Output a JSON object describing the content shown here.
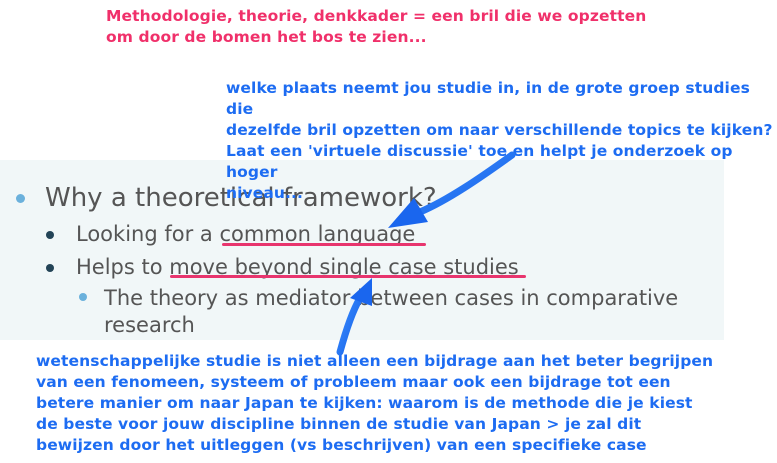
{
  "annotations": {
    "top_pink": "Methodologie, theorie, denkkader = een bril die we opzetten\nom door de bomen het bos te zien...",
    "top_blue": "welke plaats neemt jou studie in, in de grote groep studies die\ndezelfde bril opzetten om naar verschillende topics te kijken?\nLaat een 'virtuele discussie' toe en helpt je onderzoek op hoger\nniveau...",
    "bottom_blue": "wetenschappelijke studie is niet alleen een bijdrage aan het beter begrijpen\nvan een fenomeen, systeem of probleem maar ook een bijdrage tot een\nbetere manier om naar Japan te kijken: waarom is de methode die je kiest\nde beste voor jouw discipline binnen de studie van Japan > je zal dit\nbewijzen door het uitleggen (vs beschrijven) van een specifieke case"
  },
  "slide": {
    "level1": "Why a theoretical framework?",
    "level2": [
      {
        "prefix": "Looking for a ",
        "highlight": "common language"
      },
      {
        "prefix": "Helps to ",
        "highlight": "move beyond single case studies"
      }
    ],
    "level3": "The theory as mediator between cases in comparative research"
  },
  "colors": {
    "annotation_pink": "#f0306a",
    "annotation_blue": "#1d6cf2",
    "underline": "#e8356e",
    "bullet_light": "#6bb1dc",
    "bullet_dark": "#234457",
    "slide_text": "#555555"
  }
}
